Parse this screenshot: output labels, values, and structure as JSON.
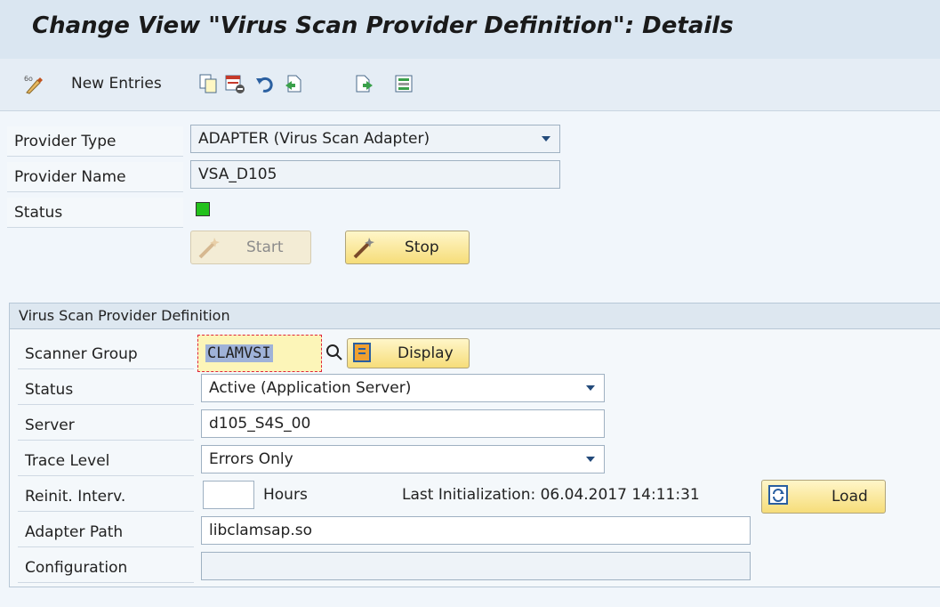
{
  "title": "Change View \"Virus Scan Provider Definition\": Details",
  "toolbar": {
    "new_entries": "New Entries",
    "icons": [
      "change-display-icon",
      "copy-icon",
      "delete-icon",
      "undo-icon",
      "previous-entry-icon",
      "next-entry-icon",
      "select-entries-icon"
    ]
  },
  "provider": {
    "type_label": "Provider Type",
    "type_value": "ADAPTER (Virus Scan Adapter)",
    "name_label": "Provider Name",
    "name_value": "VSA_D105",
    "status_label": "Status",
    "status_color": "#22c11c"
  },
  "buttons": {
    "start": "Start",
    "stop": "Stop",
    "display": "Display",
    "load": "Load"
  },
  "definition": {
    "header": "Virus Scan Provider Definition",
    "scanner_group_label": "Scanner Group",
    "scanner_group_value": "CLAMVSI",
    "status_label": "Status",
    "status_value": "Active (Application Server)",
    "server_label": "Server",
    "server_value": "d105_S4S_00",
    "trace_label": "Trace Level",
    "trace_value": "Errors Only",
    "reinit_label": "Reinit. Interv.",
    "reinit_value": "",
    "hours_label": "Hours",
    "last_init": "Last Initialization: 06.04.2017 14:11:31",
    "adapter_path_label": "Adapter Path",
    "adapter_path_value": "libclamsap.so",
    "configuration_label": "Configuration",
    "configuration_value": ""
  }
}
